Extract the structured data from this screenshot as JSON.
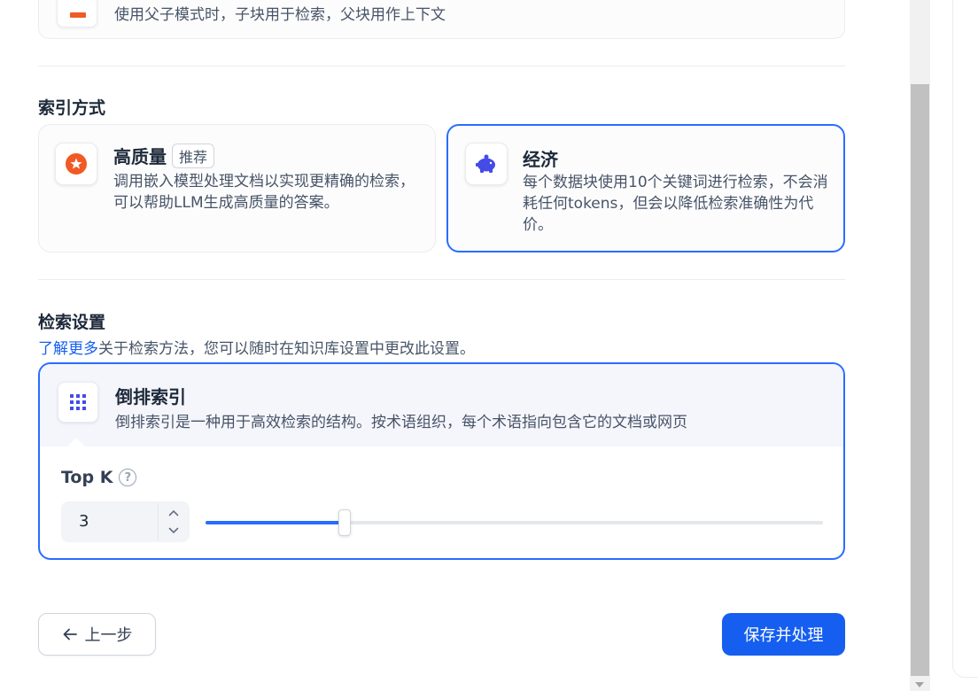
{
  "parent_child": {
    "description": "使用父子模式时，子块用于检索，父块用作上下文"
  },
  "index_method": {
    "title": "索引方式",
    "options": [
      {
        "title": "高质量",
        "badge": "推荐",
        "description": "调用嵌入模型处理文档以实现更精确的检索，可以帮助LLM生成高质量的答案。",
        "icon": "star-badge-icon",
        "selected": false
      },
      {
        "title": "经济",
        "description": "每个数据块使用10个关键词进行检索，不会消耗任何tokens，但会以降低检索准确性为代价。",
        "icon": "piggy-bank-icon",
        "selected": true
      }
    ]
  },
  "retrieval": {
    "title": "检索设置",
    "learn_more_link": "了解更多",
    "learn_more_text": "关于检索方法，您可以随时在知识库设置中更改此设置。",
    "method": {
      "title": "倒排索引",
      "description": "倒排索引是一种用于高效检索的结构。按术语组织，每个术语指向包含它的文档或网页",
      "icon": "grid-icon"
    },
    "top_k": {
      "label": "Top K",
      "value": "3",
      "slider_fraction": 0.225
    }
  },
  "footer": {
    "prev_label": "上一步",
    "save_label": "保存并处理"
  },
  "colors": {
    "accent": "#155eef",
    "selected_border": "#296dff",
    "hq_icon": "#f05a24",
    "eco_icon": "#444ce7"
  }
}
